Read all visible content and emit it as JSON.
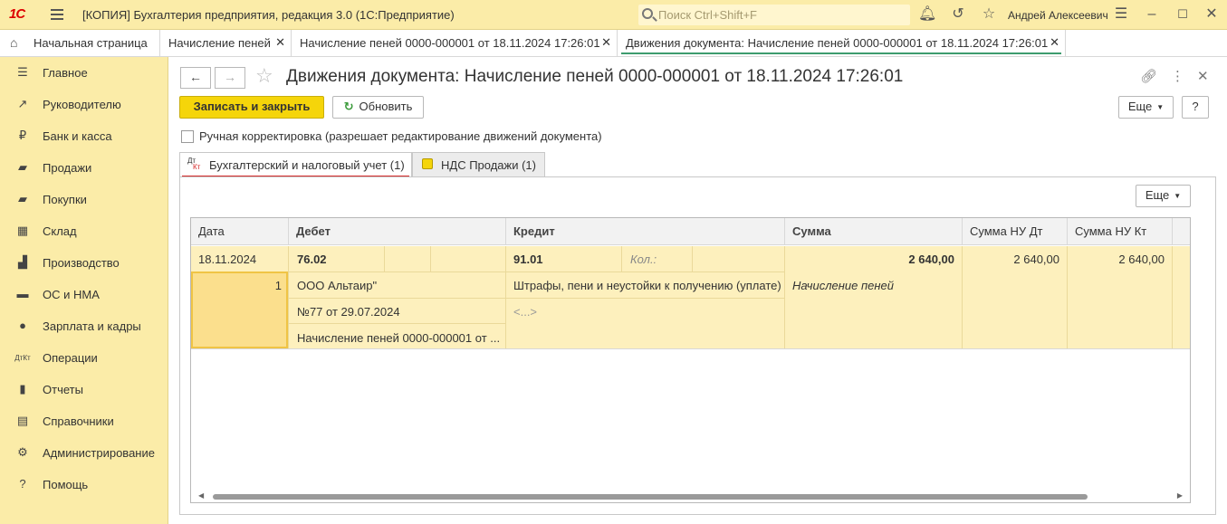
{
  "app": {
    "logo": "1С",
    "title": "[КОПИЯ] Бухгалтерия предприятия, редакция 3.0  (1С:Предприятие)",
    "search_placeholder": "Поиск Ctrl+Shift+F",
    "user": "Андрей Алексеевич",
    "icons": [
      "bell-icon",
      "history-icon",
      "star-icon",
      "settings-icon",
      "minimize-icon",
      "maximize-icon",
      "close-icon"
    ]
  },
  "open_tabs": {
    "home": "Начальная страница",
    "items": [
      {
        "label": "Начисление пеней",
        "close": "✕"
      },
      {
        "label": "Начисление пеней 0000-000001 от 18.11.2024 17:26:01",
        "close": "✕"
      },
      {
        "label": "Движения документа: Начисление пеней 0000-000001 от 18.11.2024 17:26:01",
        "close": "✕"
      }
    ]
  },
  "sidebar": {
    "items": [
      {
        "label": "Главное",
        "icon": "☰"
      },
      {
        "label": "Руководителю",
        "icon": "↗"
      },
      {
        "label": "Банк и касса",
        "icon": "₽"
      },
      {
        "label": "Продажи",
        "icon": "▰"
      },
      {
        "label": "Покупки",
        "icon": "▰"
      },
      {
        "label": "Склад",
        "icon": "▦"
      },
      {
        "label": "Производство",
        "icon": "▟"
      },
      {
        "label": "ОС и НМА",
        "icon": "▬"
      },
      {
        "label": "Зарплата и кадры",
        "icon": "●"
      },
      {
        "label": "Операции",
        "icon": "ДтКт"
      },
      {
        "label": "Отчеты",
        "icon": "▮"
      },
      {
        "label": "Справочники",
        "icon": "▤"
      },
      {
        "label": "Администрирование",
        "icon": "⚙"
      },
      {
        "label": "Помощь",
        "icon": "?"
      }
    ]
  },
  "document": {
    "title": "Движения документа: Начисление пеней 0000-000001 от 18.11.2024 17:26:01",
    "back": "←",
    "forward": "→",
    "save_close": "Записать и закрыть",
    "refresh": "Обновить",
    "more": "Еще",
    "help": "?",
    "manual_edit": "Ручная корректировка (разрешает редактирование движений документа)"
  },
  "form_tabs": [
    {
      "label": "Бухгалтерский и налоговый учет (1)",
      "active": true
    },
    {
      "label": "НДС Продажи (1)",
      "active": false
    }
  ],
  "grid": {
    "more": "Еще",
    "columns": [
      "Дата",
      "Дебет",
      "Кредит",
      "Сумма",
      "Сумма НУ Дт",
      "Сумма НУ Кт"
    ],
    "row": {
      "date": "18.11.2024",
      "number": "1",
      "debit_account": "76.02",
      "debit_subconto1": "ООО Альтаир\"",
      "debit_subconto2": "№77 от 29.07.2024",
      "debit_subconto3": "Начисление пеней 0000-000001 от ...",
      "credit_account": "91.01",
      "qty_label": "Кол.:",
      "credit_subconto1": "Штрафы, пени и неустойки к получению (уплате)",
      "credit_subconto2": "<...>",
      "amount": "2 640,00",
      "content": "Начисление пеней",
      "amount_nu_dt": "2 640,00",
      "amount_nu_kt": "2 640,00"
    }
  }
}
